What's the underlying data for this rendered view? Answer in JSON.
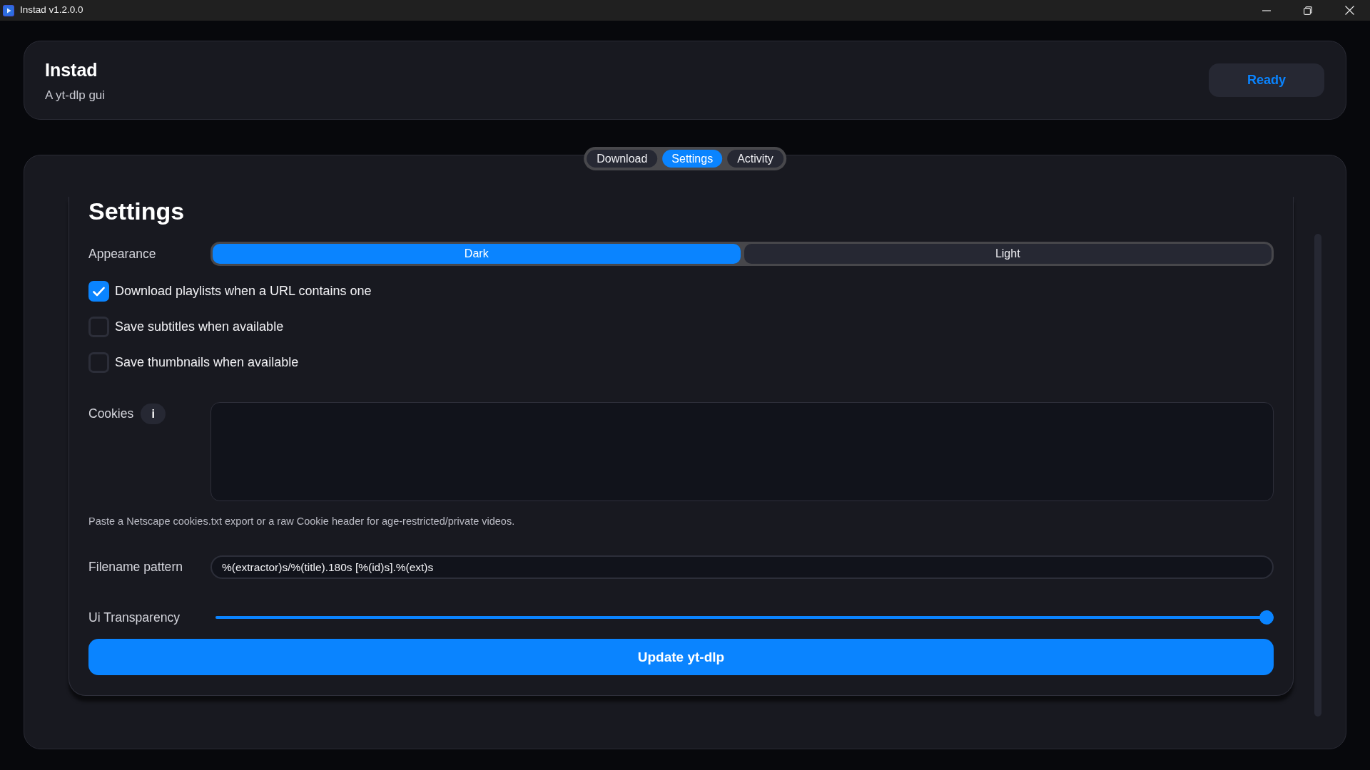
{
  "window": {
    "title": "Instad v1.2.0.0"
  },
  "header": {
    "title": "Instad",
    "subtitle": "A yt-dlp gui",
    "status": "Ready"
  },
  "tabs": [
    {
      "label": "Download",
      "selected": false
    },
    {
      "label": "Settings",
      "selected": true
    },
    {
      "label": "Activity",
      "selected": false
    }
  ],
  "settings": {
    "heading": "Settings",
    "appearance": {
      "label": "Appearance",
      "options": [
        {
          "label": "Dark",
          "selected": true
        },
        {
          "label": "Light",
          "selected": false
        }
      ]
    },
    "toggles": [
      {
        "label": "Download playlists when a URL contains one",
        "checked": true
      },
      {
        "label": "Save subtitles when available",
        "checked": false
      },
      {
        "label": "Save thumbnails when available",
        "checked": false
      }
    ],
    "cookies": {
      "label": "Cookies",
      "info": "i",
      "help": "Paste a Netscape cookies.txt export or a raw Cookie header for age-restricted/private videos."
    },
    "filename_pattern": {
      "label": "Filename pattern",
      "value": "%(extractor)s/%(title).180s [%(id)s].%(ext)s"
    },
    "transparency": {
      "label": "Ui Transparency",
      "level": 1
    },
    "update_button": "Update yt-dlp"
  }
}
